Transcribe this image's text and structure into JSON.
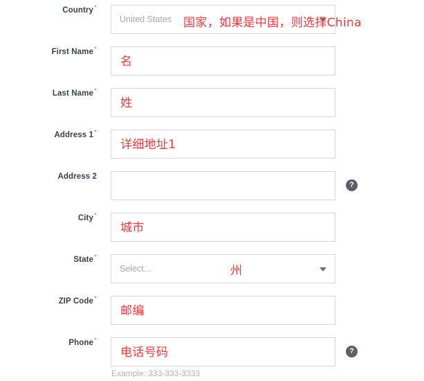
{
  "form": {
    "accent_red": "#ee3a3c",
    "label_color": "#36414f",
    "placeholder_color": "#a8a8a8",
    "border_color": "#d6d6d6",
    "required_marker": "*",
    "help_icon_glyph": "?",
    "rows": [
      {
        "name": "country",
        "label": "Country",
        "required": true,
        "control": "select",
        "placeholder": "United States",
        "annotation": "国家，如果是中国，则选择China",
        "annotation_style": "overlay-country",
        "help": false,
        "helper_text": ""
      },
      {
        "name": "first-name",
        "label": "First Name",
        "required": true,
        "control": "text",
        "placeholder": "",
        "annotation": "名",
        "annotation_style": "inside",
        "help": false,
        "helper_text": ""
      },
      {
        "name": "last-name",
        "label": "Last Name",
        "required": true,
        "control": "text",
        "placeholder": "",
        "annotation": "姓",
        "annotation_style": "inside",
        "help": false,
        "helper_text": ""
      },
      {
        "name": "address-1",
        "label": "Address 1",
        "required": true,
        "control": "text",
        "placeholder": "",
        "annotation": "详细地址1",
        "annotation_style": "inside",
        "help": false,
        "helper_text": ""
      },
      {
        "name": "address-2",
        "label": "Address 2",
        "required": false,
        "control": "text",
        "placeholder": "",
        "annotation": "",
        "annotation_style": "inside",
        "help": true,
        "helper_text": ""
      },
      {
        "name": "city",
        "label": "City",
        "required": true,
        "control": "text",
        "placeholder": "",
        "annotation": "城市",
        "annotation_style": "inside",
        "help": false,
        "helper_text": ""
      },
      {
        "name": "state",
        "label": "State",
        "required": true,
        "control": "select",
        "placeholder": "Select...",
        "annotation": "州",
        "annotation_style": "overlay-state",
        "help": false,
        "helper_text": ""
      },
      {
        "name": "zip-code",
        "label": "ZIP Code",
        "required": true,
        "control": "text",
        "placeholder": "",
        "annotation": "邮编",
        "annotation_style": "inside",
        "help": false,
        "helper_text": ""
      },
      {
        "name": "phone",
        "label": "Phone",
        "required": true,
        "control": "text",
        "placeholder": "",
        "annotation": "电话号码",
        "annotation_style": "inside",
        "help": true,
        "helper_text": "Example: 333-333-3333"
      }
    ]
  }
}
